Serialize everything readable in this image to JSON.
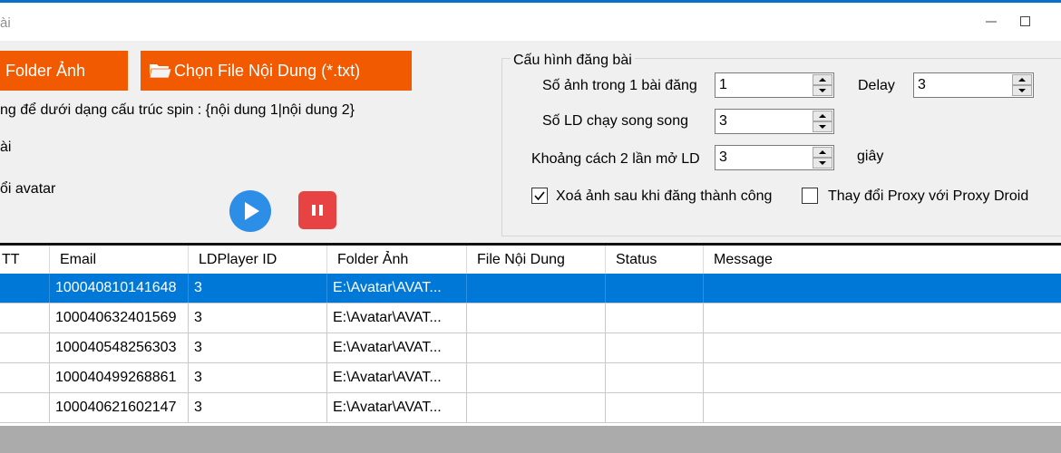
{
  "window": {
    "title": "ài"
  },
  "buttons": {
    "folder_anh": "Folder Ảnh",
    "chon_file": "Chọn File Nội Dung (*.txt)"
  },
  "left_labels": {
    "spin_hint": "ng để dưới dạng cấu trúc spin : {nội dung 1|nội dung 2}",
    "line2": "ài",
    "line3": "ổi avatar"
  },
  "config": {
    "legend": "Cấu hình đăng bài",
    "so_anh_label": "Số ảnh trong 1 bài đăng",
    "so_anh_value": "1",
    "delay_label": "Delay",
    "delay_value": "3",
    "so_ld_label": "Số LD chạy song song",
    "so_ld_value": "3",
    "khoang_cach_label": "Khoảng cách 2 lần mở LD",
    "khoang_cach_value": "3",
    "giay_label": "giây",
    "xoa_anh_label": "Xoá ảnh sau khi đăng thành công",
    "xoa_anh_checked": true,
    "proxy_label": "Thay đổi Proxy với Proxy Droid",
    "proxy_checked": false
  },
  "table": {
    "headers": [
      "TT",
      "Email",
      "LDPlayer ID",
      "Folder Ảnh",
      "File Nội Dung",
      "Status",
      "Message"
    ],
    "rows": [
      [
        "",
        "100040810141648",
        "3",
        "E:\\Avatar\\AVAT...",
        "",
        "",
        ""
      ],
      [
        "",
        "100040632401569",
        "3",
        "E:\\Avatar\\AVAT...",
        "",
        "",
        ""
      ],
      [
        "",
        "100040548256303",
        "3",
        "E:\\Avatar\\AVAT...",
        "",
        "",
        ""
      ],
      [
        "",
        "100040499268861",
        "3",
        "E:\\Avatar\\AVAT...",
        "",
        "",
        ""
      ],
      [
        "",
        "100040621602147",
        "3",
        "E:\\Avatar\\AVAT...",
        "",
        "",
        ""
      ]
    ],
    "selected_row": 0
  },
  "icons": {
    "play": "play-icon",
    "stop": "pause-icon",
    "folder": "folder-icon",
    "minimize": "minimize-icon",
    "maximize": "maximize-icon"
  },
  "colors": {
    "accent_orange": "#f25a00",
    "play_blue": "#2d8ee7",
    "stop_red": "#e84343",
    "selection_blue": "#0078d7"
  }
}
